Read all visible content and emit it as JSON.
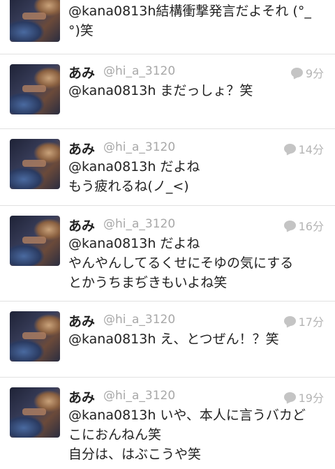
{
  "tweets": [
    {
      "name": "",
      "handle": "",
      "time": "",
      "lines": [
        "@kana0813h結構衝撃発言だよそれ (°_",
        "°)笑"
      ]
    },
    {
      "name": "あみ",
      "handle": "@hi_a_3120",
      "time": "9分",
      "lines": [
        "@kana0813h まだっしょ？笑"
      ]
    },
    {
      "name": "あみ",
      "handle": "@hi_a_3120",
      "time": "14分",
      "lines": [
        "@kana0813h だよね",
        "もう疲れるね(ノ_<)"
      ]
    },
    {
      "name": "あみ",
      "handle": "@hi_a_3120",
      "time": "16分",
      "lines": [
        "@kana0813h だよね",
        "やんやんしてるくせにそゆの気にする",
        "とかうちまぢきもいよね笑"
      ]
    },
    {
      "name": "あみ",
      "handle": "@hi_a_3120",
      "time": "17分",
      "lines": [
        "@kana0813h え、とつぜん！？笑"
      ]
    },
    {
      "name": "あみ",
      "handle": "@hi_a_3120",
      "time": "19分",
      "lines": [
        "@kana0813h いや、本人に言うバカど",
        "こにおんねん笑",
        "自分は、はぶこうや笑"
      ]
    }
  ],
  "icons": {
    "reply": "speech-bubble-icon"
  }
}
